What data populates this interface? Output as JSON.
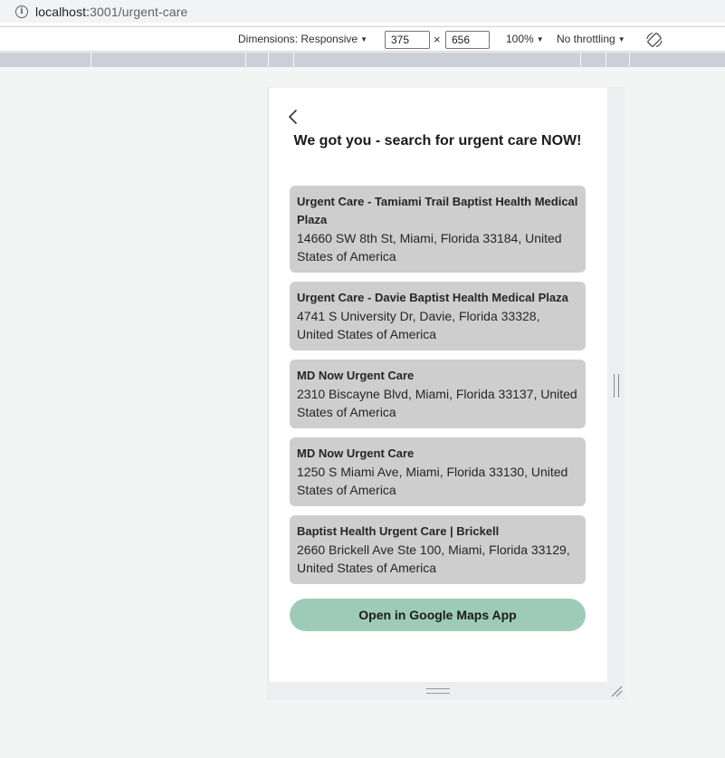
{
  "browser": {
    "url_host": "localhost:",
    "url_path": "3001/urgent-care"
  },
  "devtools": {
    "dimensions_label": "Dimensions: Responsive",
    "width_value": "375",
    "height_value": "656",
    "times_sign": "×",
    "zoom": "100%",
    "throttling": "No throttling"
  },
  "page": {
    "title": "We got you - search for urgent care NOW!",
    "locations": [
      {
        "name": "Urgent Care - Tamiami Trail Baptist Health Medical Plaza",
        "address": "14660 SW 8th St, Miami, Florida 33184, United States of America"
      },
      {
        "name": "Urgent Care - Davie Baptist Health Medical Plaza",
        "address": "4741 S University Dr, Davie, Florida 33328, United States of America"
      },
      {
        "name": "MD Now Urgent Care",
        "address": "2310 Biscayne Blvd, Miami, Florida 33137, United States of America"
      },
      {
        "name": "MD Now Urgent Care",
        "address": "1250 S Miami Ave, Miami, Florida 33130, United States of America"
      },
      {
        "name": "Baptist Health Urgent Care | Brickell",
        "address": "2660 Brickell Ave Ste 100, Miami, Florida 33129, United States of America"
      }
    ],
    "maps_button_label": "Open in Google Maps App"
  },
  "icons": {
    "info": "info-icon",
    "back": "chevron-left-icon",
    "rotate": "rotate-icon"
  },
  "colors": {
    "card_bg": "#cecece",
    "button_bg": "#9ecbb7",
    "ruler": "#cbd0d8"
  }
}
